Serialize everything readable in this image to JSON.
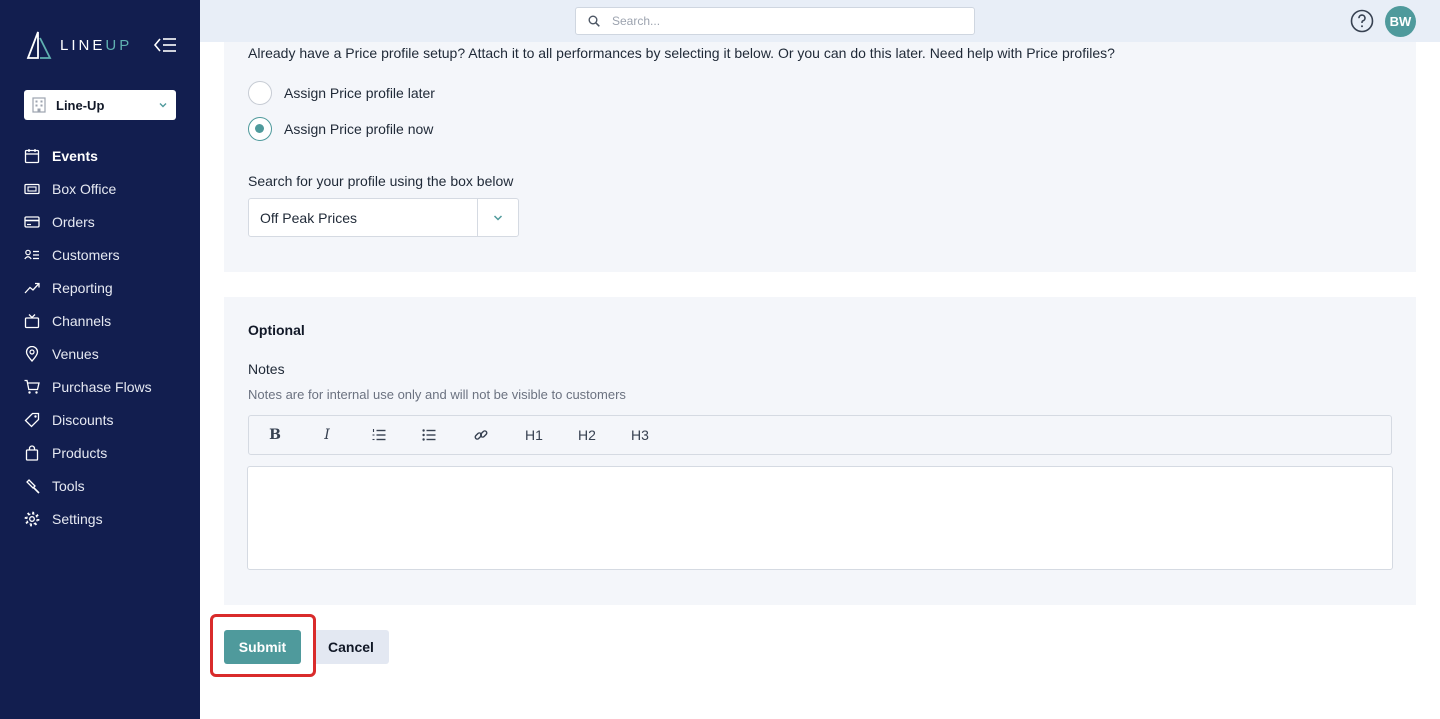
{
  "brand": {
    "logo_text_line": "LINE",
    "logo_text_up": "UP"
  },
  "organization": {
    "selected": "Line-Up"
  },
  "nav": {
    "items": [
      {
        "label": "Events",
        "icon": "calendar-icon",
        "active": true
      },
      {
        "label": "Box Office",
        "icon": "ticket-icon",
        "active": false
      },
      {
        "label": "Orders",
        "icon": "credit-card-icon",
        "active": false
      },
      {
        "label": "Customers",
        "icon": "contacts-icon",
        "active": false
      },
      {
        "label": "Reporting",
        "icon": "trend-icon",
        "active": false
      },
      {
        "label": "Channels",
        "icon": "tv-icon",
        "active": false
      },
      {
        "label": "Venues",
        "icon": "map-pin-icon",
        "active": false
      },
      {
        "label": "Purchase Flows",
        "icon": "cart-icon",
        "active": false
      },
      {
        "label": "Discounts",
        "icon": "tag-icon",
        "active": false
      },
      {
        "label": "Products",
        "icon": "bag-icon",
        "active": false
      },
      {
        "label": "Tools",
        "icon": "hammer-icon",
        "active": false
      },
      {
        "label": "Settings",
        "icon": "gear-icon",
        "active": false
      }
    ]
  },
  "topbar": {
    "search_placeholder": "Search...",
    "avatar_initials": "BW"
  },
  "price_profile": {
    "intro": "Already have a Price profile setup? Attach it to all performances by selecting it below. Or you can do this later. Need help with Price profiles?",
    "options": [
      {
        "label": "Assign Price profile later",
        "checked": false
      },
      {
        "label": "Assign Price profile now",
        "checked": true
      }
    ],
    "search_label": "Search for your profile using the box below",
    "selected_profile": "Off Peak Prices"
  },
  "optional": {
    "title": "Optional",
    "notes_label": "Notes",
    "notes_help": "Notes are for internal use only and will not be visible to customers",
    "toolbar": {
      "bold": "B",
      "italic": "I",
      "h1": "H1",
      "h2": "H2",
      "h3": "H3"
    },
    "notes_value": ""
  },
  "actions": {
    "submit": "Submit",
    "cancel": "Cancel"
  },
  "colors": {
    "sidebar_bg": "#121e4f",
    "accent": "#4f9a9c",
    "highlight": "#d92b2b"
  }
}
